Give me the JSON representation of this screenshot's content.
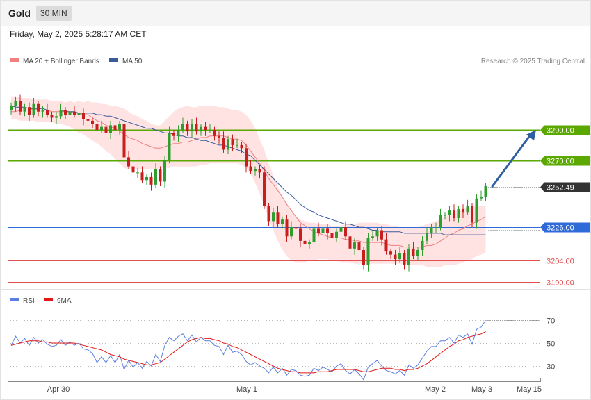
{
  "header": {
    "instrument": "Gold",
    "interval": "30 MIN"
  },
  "timestamp": "Friday, May 2, 2025 5:28:17 AM CET",
  "copyright": "Research © 2025 Trading Central",
  "colors": {
    "up": "#2e9e2e",
    "down": "#c81e1e",
    "ma20": "#f08080",
    "bands": "#ffe3e3",
    "ma50": "#3a5a9a",
    "resistance": "#5aa800",
    "support": "#2f6bd8",
    "lower_levels": "#e05050",
    "price": "#333333",
    "arrow": "#2f5fa0",
    "rsi": "#5b7fe0",
    "rsi_ma": "#e01818"
  },
  "chart_data": [
    {
      "type": "line",
      "title": "",
      "legend": [
        {
          "name": "MA 20 + Bollinger Bands",
          "color": "#f08080"
        },
        {
          "name": "MA 50",
          "color": "#3a5a9a"
        }
      ],
      "x_ticks": [
        "Apr 30",
        "May 1",
        "May 2",
        "May 3",
        "May 15"
      ],
      "ylim": [
        3184,
        3316
      ],
      "levels": [
        {
          "label": "3290.00",
          "value": 3290,
          "kind": "resistance"
        },
        {
          "label": "3270.00",
          "value": 3270,
          "kind": "resistance"
        },
        {
          "label": "3252.49",
          "value": 3252.49,
          "kind": "price"
        },
        {
          "label": "3226.00",
          "value": 3226,
          "kind": "support"
        },
        {
          "label": "3204.00",
          "value": 3204,
          "kind": "minor"
        },
        {
          "label": "3190.00",
          "value": 3190,
          "kind": "minor"
        }
      ],
      "projection": {
        "from": 3252.49,
        "to": 3290
      },
      "candle_closes": [
        3306,
        3309,
        3302,
        3305,
        3300,
        3307,
        3302,
        3303,
        3300,
        3298,
        3299,
        3303,
        3300,
        3302,
        3300,
        3301,
        3297,
        3296,
        3294,
        3290,
        3292,
        3288,
        3293,
        3290,
        3294,
        3272,
        3266,
        3262,
        3262,
        3257,
        3259,
        3254,
        3264,
        3256,
        3270,
        3288,
        3286,
        3290,
        3294,
        3289,
        3294,
        3289,
        3292,
        3290,
        3290,
        3286,
        3285,
        3277,
        3284,
        3280,
        3280,
        3278,
        3266,
        3263,
        3264,
        3262,
        3240,
        3230,
        3236,
        3228,
        3231,
        3220,
        3226,
        3225,
        3217,
        3215,
        3216,
        3225,
        3222,
        3225,
        3222,
        3219,
        3223,
        3226,
        3220,
        3212,
        3216,
        3211,
        3201,
        3219,
        3220,
        3224,
        3218,
        3210,
        3208,
        3205,
        3209,
        3201,
        3212,
        3207,
        3211,
        3217,
        3222,
        3226,
        3226,
        3234,
        3234,
        3237,
        3232,
        3238,
        3236,
        3240,
        3229,
        3245,
        3246,
        3253
      ],
      "ma20": [
        3302,
        3302,
        3303,
        3303,
        3303,
        3304,
        3303,
        3303,
        3303,
        3302,
        3302,
        3302,
        3302,
        3302,
        3301,
        3301,
        3300,
        3300,
        3298,
        3296,
        3295,
        3293,
        3292,
        3291,
        3289,
        3287,
        3285,
        3284,
        3283,
        3281,
        3280,
        3279,
        3278,
        3278,
        3279,
        3280,
        3281,
        3281,
        3282,
        3282,
        3283,
        3284,
        3285,
        3285,
        3286,
        3286,
        3286,
        3286,
        3285,
        3284,
        3284,
        3283,
        3280,
        3276,
        3272,
        3268,
        3263,
        3258,
        3254,
        3250,
        3246,
        3241,
        3237,
        3233,
        3229,
        3227,
        3225,
        3223,
        3222,
        3221,
        3220,
        3219,
        3219,
        3219,
        3218,
        3218,
        3217,
        3217,
        3216,
        3216,
        3216,
        3216,
        3216,
        3215,
        3214,
        3214,
        3214,
        3213,
        3213,
        3213,
        3213,
        3213,
        3214,
        3214,
        3215,
        3217,
        3219,
        3221,
        3222,
        3224,
        3225,
        3227,
        3228,
        3230,
        3231,
        3233
      ],
      "bb_upper": [
        3312,
        3312,
        3311,
        3311,
        3311,
        3310,
        3310,
        3310,
        3310,
        3309,
        3309,
        3309,
        3308,
        3309,
        3308,
        3309,
        3308,
        3309,
        3308,
        3308,
        3307,
        3307,
        3306,
        3306,
        3305,
        3304,
        3302,
        3300,
        3299,
        3297,
        3296,
        3294,
        3293,
        3293,
        3296,
        3299,
        3302,
        3304,
        3305,
        3306,
        3305,
        3305,
        3306,
        3306,
        3306,
        3306,
        3305,
        3305,
        3304,
        3303,
        3303,
        3302,
        3300,
        3296,
        3291,
        3284,
        3277,
        3268,
        3260,
        3253,
        3246,
        3241,
        3236,
        3233,
        3231,
        3230,
        3229,
        3229,
        3228,
        3228,
        3228,
        3227,
        3227,
        3227,
        3228,
        3228,
        3228,
        3229,
        3229,
        3229,
        3229,
        3229,
        3228,
        3228,
        3227,
        3227,
        3226,
        3226,
        3226,
        3226,
        3226,
        3227,
        3228,
        3229,
        3230,
        3231,
        3233,
        3234,
        3236,
        3237,
        3238,
        3239,
        3239,
        3240,
        3240,
        3240
      ],
      "bb_lower": [
        3297,
        3297,
        3296,
        3296,
        3296,
        3296,
        3295,
        3295,
        3295,
        3295,
        3294,
        3294,
        3293,
        3292,
        3290,
        3288,
        3287,
        3285,
        3283,
        3281,
        3279,
        3276,
        3274,
        3271,
        3268,
        3265,
        3264,
        3264,
        3264,
        3264,
        3264,
        3264,
        3264,
        3265,
        3265,
        3265,
        3266,
        3266,
        3266,
        3266,
        3266,
        3266,
        3267,
        3267,
        3268,
        3268,
        3268,
        3268,
        3268,
        3268,
        3268,
        3267,
        3265,
        3261,
        3255,
        3248,
        3240,
        3232,
        3224,
        3217,
        3211,
        3207,
        3204,
        3203,
        3203,
        3203,
        3204,
        3204,
        3205,
        3205,
        3205,
        3204,
        3204,
        3203,
        3203,
        3203,
        3202,
        3202,
        3202,
        3202,
        3202,
        3202,
        3202,
        3202,
        3202,
        3202,
        3202,
        3202,
        3201,
        3201,
        3201,
        3201,
        3200,
        3200,
        3200,
        3200,
        3201,
        3201,
        3201,
        3202,
        3203,
        3204,
        3205,
        3207,
        3208,
        3209
      ],
      "ma50": [
        3306,
        3305,
        3305,
        3305,
        3304,
        3304,
        3304,
        3304,
        3303,
        3303,
        3303,
        3303,
        3302,
        3302,
        3302,
        3301,
        3301,
        3301,
        3301,
        3300,
        3300,
        3299,
        3299,
        3298,
        3297,
        3296,
        3295,
        3294,
        3293,
        3292,
        3291,
        3291,
        3290,
        3289,
        3288,
        3288,
        3287,
        3286,
        3286,
        3285,
        3285,
        3284,
        3283,
        3283,
        3282,
        3281,
        3280,
        3280,
        3279,
        3278,
        3277,
        3276,
        3274,
        3273,
        3270,
        3267,
        3264,
        3261,
        3258,
        3255,
        3252,
        3249,
        3247,
        3244,
        3241,
        3239,
        3237,
        3236,
        3234,
        3233,
        3232,
        3231,
        3230,
        3229,
        3228,
        3228,
        3227,
        3226,
        3226,
        3225,
        3224,
        3224,
        3223,
        3223,
        3223,
        3223,
        3223,
        3222,
        3222,
        3222,
        3222,
        3222,
        3222,
        3222,
        3222,
        3222,
        3221,
        3221,
        3221,
        3221,
        3221,
        3221,
        3221,
        3221,
        3221,
        3221
      ]
    },
    {
      "type": "line",
      "title": "",
      "legend": [
        {
          "name": "RSI",
          "color": "#5b7fe0"
        },
        {
          "name": "9MA",
          "color": "#e01818"
        }
      ],
      "ylim": [
        20,
        80
      ],
      "y_ticks": [
        70,
        50,
        30
      ],
      "rsi": [
        48,
        56,
        50,
        54,
        48,
        55,
        50,
        53,
        49,
        47,
        48,
        53,
        48,
        51,
        48,
        50,
        45,
        44,
        41,
        33,
        38,
        33,
        39,
        33,
        40,
        27,
        35,
        29,
        33,
        28,
        34,
        30,
        40,
        34,
        48,
        55,
        52,
        56,
        58,
        52,
        57,
        51,
        55,
        52,
        52,
        48,
        47,
        40,
        48,
        42,
        43,
        40,
        34,
        31,
        33,
        30,
        28,
        24,
        29,
        24,
        28,
        22,
        27,
        26,
        22,
        21,
        22,
        28,
        26,
        29,
        27,
        25,
        30,
        32,
        26,
        23,
        27,
        23,
        18,
        29,
        32,
        35,
        30,
        26,
        25,
        23,
        26,
        22,
        31,
        28,
        31,
        37,
        43,
        47,
        47,
        52,
        52,
        55,
        50,
        57,
        55,
        58,
        49,
        62,
        64,
        70
      ],
      "ma9": [
        48,
        49,
        50,
        51,
        52,
        52,
        52,
        51,
        51,
        50,
        50,
        50,
        50,
        50,
        50,
        49,
        48,
        47,
        46,
        45,
        44,
        42,
        40,
        39,
        38,
        36,
        35,
        34,
        33,
        32,
        31,
        31,
        32,
        33,
        36,
        39,
        42,
        45,
        48,
        51,
        53,
        54,
        55,
        54,
        54,
        53,
        52,
        50,
        49,
        47,
        46,
        44,
        42,
        40,
        38,
        36,
        34,
        32,
        30,
        28,
        27,
        26,
        25,
        25,
        24,
        24,
        24,
        24,
        25,
        25,
        25,
        26,
        27,
        27,
        27,
        27,
        27,
        26,
        25,
        25,
        26,
        27,
        28,
        28,
        28,
        27,
        27,
        26,
        27,
        27,
        28,
        30,
        32,
        35,
        38,
        41,
        44,
        47,
        49,
        52,
        53,
        55,
        56,
        57,
        58,
        60
      ]
    }
  ],
  "rsi_legend": [
    {
      "label": "RSI"
    },
    {
      "label": "9MA"
    }
  ]
}
